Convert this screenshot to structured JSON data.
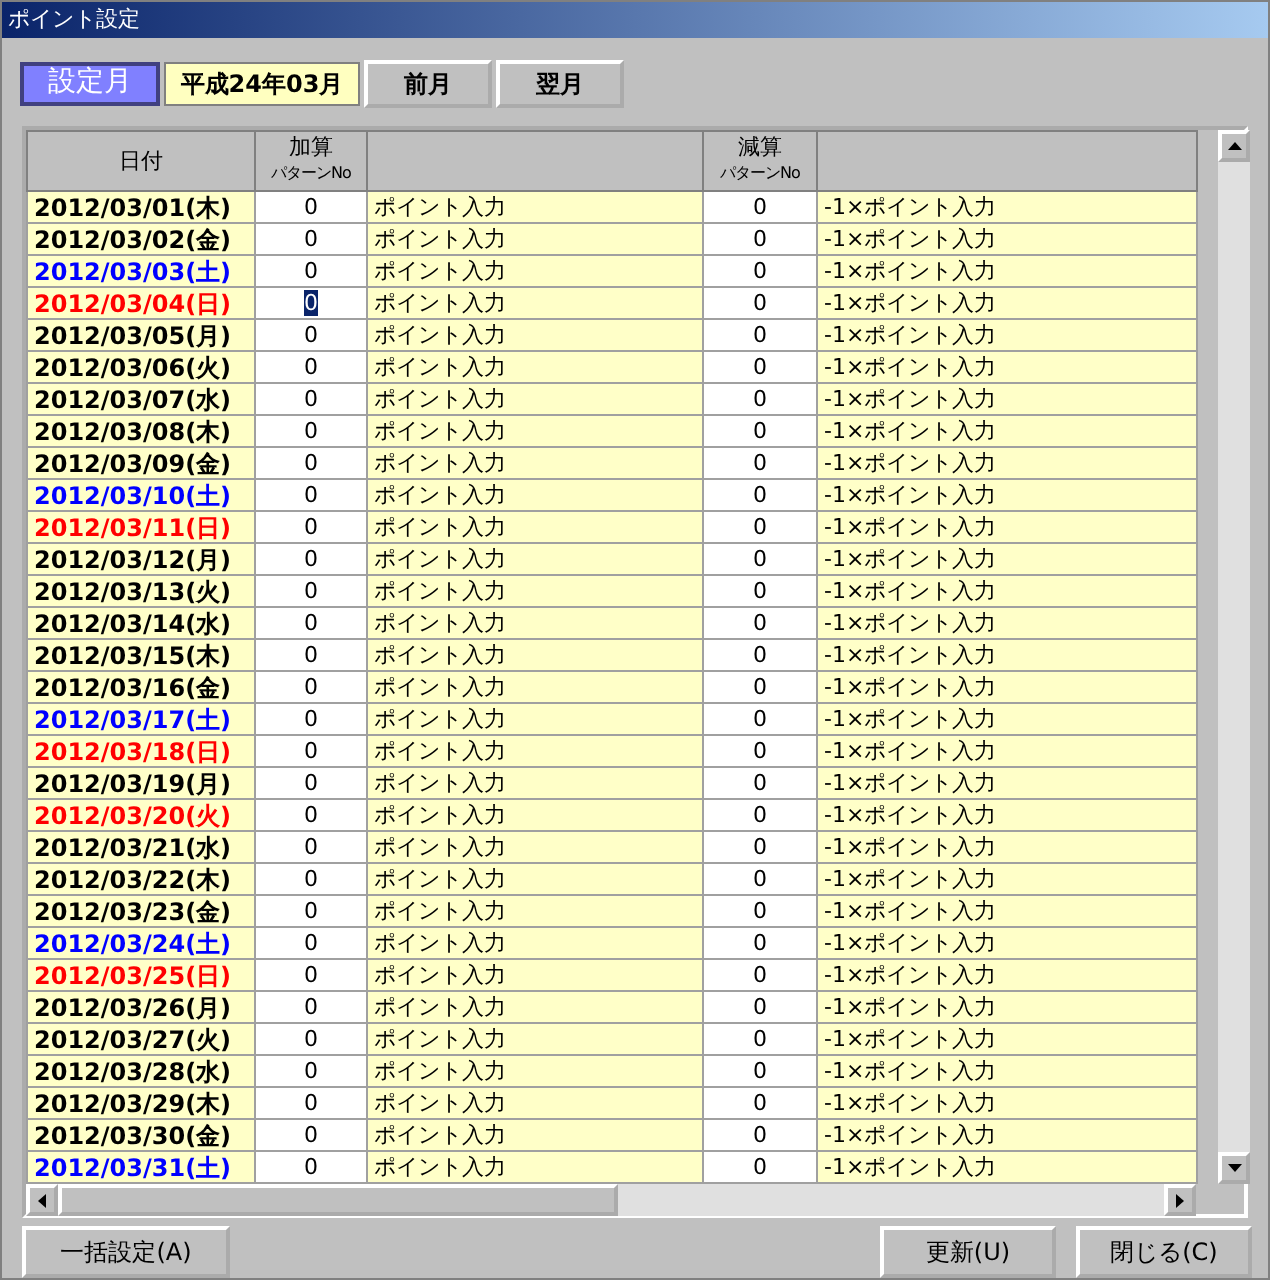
{
  "window": {
    "title": "ポイント設定"
  },
  "toolbar": {
    "month_label": "設定月",
    "month_value": "平成24年03月",
    "buttons": [
      "前月",
      "翌月"
    ]
  },
  "table": {
    "columns": [
      {
        "label": "日付"
      },
      {
        "label": "加算",
        "sublabel": "パターンNo"
      },
      {},
      {
        "label": "減算",
        "sublabel": "パターンNo"
      },
      {}
    ],
    "rows": [
      {
        "date": "2012/03/01(木)",
        "color": "#000000",
        "add_no": "0",
        "add_label": "ポイント入力",
        "sub_no": "0",
        "sub_label": "-1×ポイント入力",
        "selected": false
      },
      {
        "date": "2012/03/02(金)",
        "color": "#000000",
        "add_no": "0",
        "add_label": "ポイント入力",
        "sub_no": "0",
        "sub_label": "-1×ポイント入力",
        "selected": false
      },
      {
        "date": "2012/03/03(土)",
        "color": "#0000ff",
        "add_no": "0",
        "add_label": "ポイント入力",
        "sub_no": "0",
        "sub_label": "-1×ポイント入力",
        "selected": false
      },
      {
        "date": "2012/03/04(日)",
        "color": "#ff0000",
        "add_no": "0",
        "add_label": "ポイント入力",
        "sub_no": "0",
        "sub_label": "-1×ポイント入力",
        "selected": true
      },
      {
        "date": "2012/03/05(月)",
        "color": "#000000",
        "add_no": "0",
        "add_label": "ポイント入力",
        "sub_no": "0",
        "sub_label": "-1×ポイント入力",
        "selected": false
      },
      {
        "date": "2012/03/06(火)",
        "color": "#000000",
        "add_no": "0",
        "add_label": "ポイント入力",
        "sub_no": "0",
        "sub_label": "-1×ポイント入力",
        "selected": false
      },
      {
        "date": "2012/03/07(水)",
        "color": "#000000",
        "add_no": "0",
        "add_label": "ポイント入力",
        "sub_no": "0",
        "sub_label": "-1×ポイント入力",
        "selected": false
      },
      {
        "date": "2012/03/08(木)",
        "color": "#000000",
        "add_no": "0",
        "add_label": "ポイント入力",
        "sub_no": "0",
        "sub_label": "-1×ポイント入力",
        "selected": false
      },
      {
        "date": "2012/03/09(金)",
        "color": "#000000",
        "add_no": "0",
        "add_label": "ポイント入力",
        "sub_no": "0",
        "sub_label": "-1×ポイント入力",
        "selected": false
      },
      {
        "date": "2012/03/10(土)",
        "color": "#0000ff",
        "add_no": "0",
        "add_label": "ポイント入力",
        "sub_no": "0",
        "sub_label": "-1×ポイント入力",
        "selected": false
      },
      {
        "date": "2012/03/11(日)",
        "color": "#ff0000",
        "add_no": "0",
        "add_label": "ポイント入力",
        "sub_no": "0",
        "sub_label": "-1×ポイント入力",
        "selected": false
      },
      {
        "date": "2012/03/12(月)",
        "color": "#000000",
        "add_no": "0",
        "add_label": "ポイント入力",
        "sub_no": "0",
        "sub_label": "-1×ポイント入力",
        "selected": false
      },
      {
        "date": "2012/03/13(火)",
        "color": "#000000",
        "add_no": "0",
        "add_label": "ポイント入力",
        "sub_no": "0",
        "sub_label": "-1×ポイント入力",
        "selected": false
      },
      {
        "date": "2012/03/14(水)",
        "color": "#000000",
        "add_no": "0",
        "add_label": "ポイント入力",
        "sub_no": "0",
        "sub_label": "-1×ポイント入力",
        "selected": false
      },
      {
        "date": "2012/03/15(木)",
        "color": "#000000",
        "add_no": "0",
        "add_label": "ポイント入力",
        "sub_no": "0",
        "sub_label": "-1×ポイント入力",
        "selected": false
      },
      {
        "date": "2012/03/16(金)",
        "color": "#000000",
        "add_no": "0",
        "add_label": "ポイント入力",
        "sub_no": "0",
        "sub_label": "-1×ポイント入力",
        "selected": false
      },
      {
        "date": "2012/03/17(土)",
        "color": "#0000ff",
        "add_no": "0",
        "add_label": "ポイント入力",
        "sub_no": "0",
        "sub_label": "-1×ポイント入力",
        "selected": false
      },
      {
        "date": "2012/03/18(日)",
        "color": "#ff0000",
        "add_no": "0",
        "add_label": "ポイント入力",
        "sub_no": "0",
        "sub_label": "-1×ポイント入力",
        "selected": false
      },
      {
        "date": "2012/03/19(月)",
        "color": "#000000",
        "add_no": "0",
        "add_label": "ポイント入力",
        "sub_no": "0",
        "sub_label": "-1×ポイント入力",
        "selected": false
      },
      {
        "date": "2012/03/20(火)",
        "color": "#ff0000",
        "add_no": "0",
        "add_label": "ポイント入力",
        "sub_no": "0",
        "sub_label": "-1×ポイント入力",
        "selected": false
      },
      {
        "date": "2012/03/21(水)",
        "color": "#000000",
        "add_no": "0",
        "add_label": "ポイント入力",
        "sub_no": "0",
        "sub_label": "-1×ポイント入力",
        "selected": false
      },
      {
        "date": "2012/03/22(木)",
        "color": "#000000",
        "add_no": "0",
        "add_label": "ポイント入力",
        "sub_no": "0",
        "sub_label": "-1×ポイント入力",
        "selected": false
      },
      {
        "date": "2012/03/23(金)",
        "color": "#000000",
        "add_no": "0",
        "add_label": "ポイント入力",
        "sub_no": "0",
        "sub_label": "-1×ポイント入力",
        "selected": false
      },
      {
        "date": "2012/03/24(土)",
        "color": "#0000ff",
        "add_no": "0",
        "add_label": "ポイント入力",
        "sub_no": "0",
        "sub_label": "-1×ポイント入力",
        "selected": false
      },
      {
        "date": "2012/03/25(日)",
        "color": "#ff0000",
        "add_no": "0",
        "add_label": "ポイント入力",
        "sub_no": "0",
        "sub_label": "-1×ポイント入力",
        "selected": false
      },
      {
        "date": "2012/03/26(月)",
        "color": "#000000",
        "add_no": "0",
        "add_label": "ポイント入力",
        "sub_no": "0",
        "sub_label": "-1×ポイント入力",
        "selected": false
      },
      {
        "date": "2012/03/27(火)",
        "color": "#000000",
        "add_no": "0",
        "add_label": "ポイント入力",
        "sub_no": "0",
        "sub_label": "-1×ポイント入力",
        "selected": false
      },
      {
        "date": "2012/03/28(水)",
        "color": "#000000",
        "add_no": "0",
        "add_label": "ポイント入力",
        "sub_no": "0",
        "sub_label": "-1×ポイント入力",
        "selected": false
      },
      {
        "date": "2012/03/29(木)",
        "color": "#000000",
        "add_no": "0",
        "add_label": "ポイント入力",
        "sub_no": "0",
        "sub_label": "-1×ポイント入力",
        "selected": false
      },
      {
        "date": "2012/03/30(金)",
        "color": "#000000",
        "add_no": "0",
        "add_label": "ポイント入力",
        "sub_no": "0",
        "sub_label": "-1×ポイント入力",
        "selected": false
      },
      {
        "date": "2012/03/31(土)",
        "color": "#0000ff",
        "add_no": "0",
        "add_label": "ポイント入力",
        "sub_no": "0",
        "sub_label": "-1×ポイント入力",
        "selected": false
      }
    ]
  },
  "footer": {
    "left_button": "一括設定(A)",
    "right_buttons": [
      "更新(U)",
      "閉じる(C)"
    ]
  }
}
